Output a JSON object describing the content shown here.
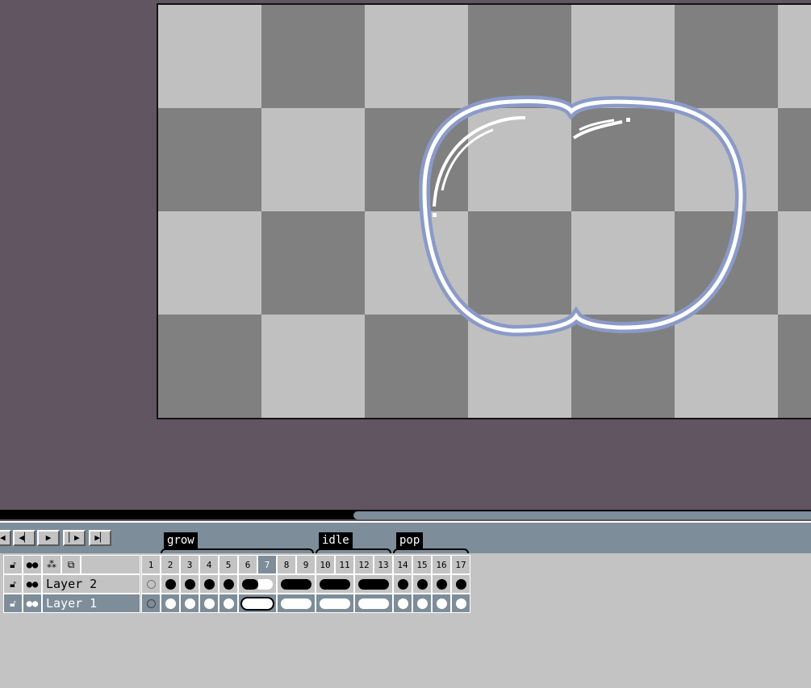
{
  "timeline": {
    "playback": [
      "first-frame",
      "prev-frame",
      "play",
      "next-frame",
      "last-frame"
    ],
    "tags": [
      {
        "label": "grow",
        "from": 2,
        "to": 9
      },
      {
        "label": "idle",
        "from": 10,
        "to": 13
      },
      {
        "label": "pop",
        "from": 14,
        "to": 17
      }
    ],
    "frames": [
      "1",
      "2",
      "3",
      "4",
      "5",
      "6",
      "7",
      "8",
      "9",
      "10",
      "11",
      "12",
      "13",
      "14",
      "15",
      "16",
      "17"
    ],
    "current_frame": "7",
    "header_icons": [
      "lock-icon",
      "visibility-icon",
      "link-icon",
      "continuous-icon"
    ],
    "layers": [
      {
        "name": "Layer 2",
        "selected": false
      },
      {
        "name": "Layer 1",
        "selected": true
      }
    ]
  },
  "colors": {
    "workspace": "#615561",
    "timeline_bg": "#c3c3c3",
    "header_bg": "#7d8d99",
    "checker_light": "#c0c0c0",
    "checker_dark": "#808080",
    "bubble_outline": "#ffffff",
    "bubble_shadow": "#8a9ac8"
  },
  "scrollbar": {
    "thumb_position_fraction": 0.44
  }
}
